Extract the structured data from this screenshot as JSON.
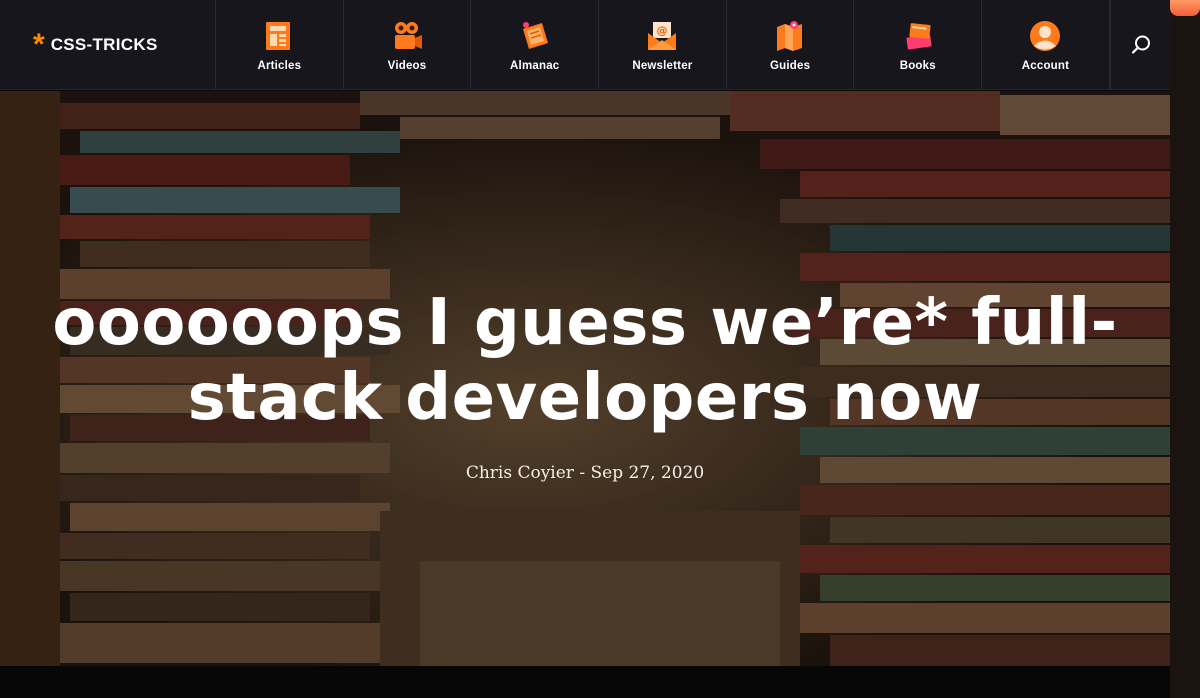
{
  "site": {
    "logo_mark": "*",
    "name": "CSS-TRICKS"
  },
  "nav": {
    "items": [
      {
        "label": "Articles",
        "icon": "articles-icon"
      },
      {
        "label": "Videos",
        "icon": "videos-icon"
      },
      {
        "label": "Almanac",
        "icon": "almanac-icon"
      },
      {
        "label": "Newsletter",
        "icon": "newsletter-icon"
      },
      {
        "label": "Guides",
        "icon": "guides-icon"
      },
      {
        "label": "Books",
        "icon": "books-icon"
      },
      {
        "label": "Account",
        "icon": "account-icon"
      }
    ],
    "search_icon": "search-icon"
  },
  "hero": {
    "title_line1": "oooooops I guess we’re* full-",
    "title_line2": "stack developers now",
    "byline": "Chris Coyier - Sep 27, 2020"
  },
  "colors": {
    "accent": "#ff8a00",
    "nav_bg": "#16161c",
    "text": "#ffffff"
  }
}
